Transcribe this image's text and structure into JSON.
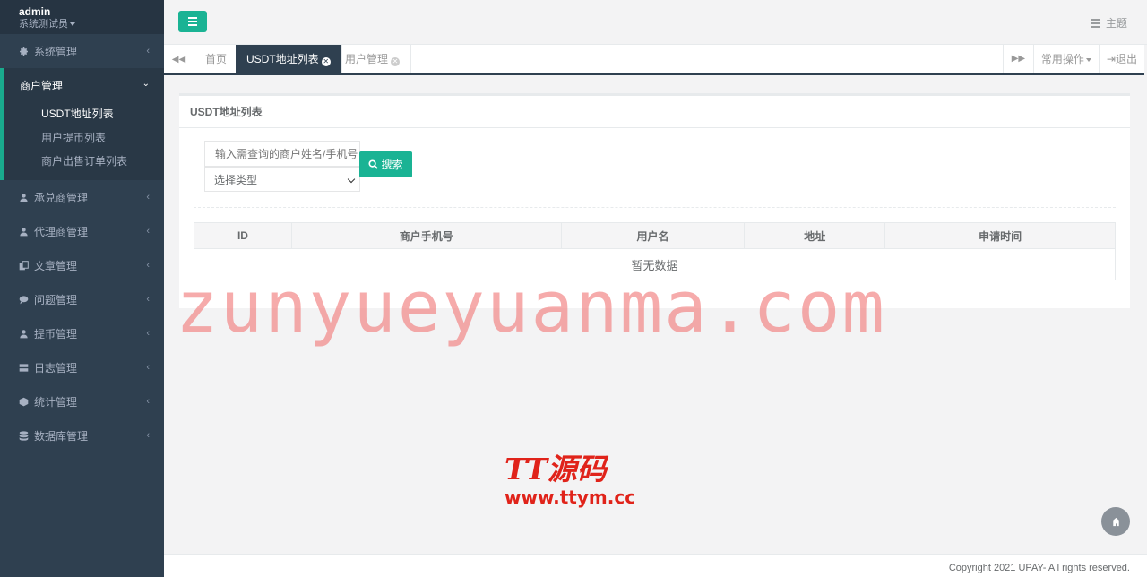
{
  "user": {
    "name": "admin",
    "role": "系统测试员"
  },
  "sidebar": {
    "items_top": [
      {
        "label": "系统管理",
        "icon": "gear-icon"
      }
    ],
    "active": {
      "label": "商户管理",
      "icon": "user-icon",
      "children": [
        {
          "label": "USDT地址列表",
          "current": true
        },
        {
          "label": "用户提币列表"
        },
        {
          "label": "商户出售订单列表"
        }
      ]
    },
    "items_bottom": [
      {
        "label": "承兑商管理",
        "icon": "user-icon"
      },
      {
        "label": "代理商管理",
        "icon": "user-icon"
      },
      {
        "label": "文章管理",
        "icon": "copy-icon"
      },
      {
        "label": "问题管理",
        "icon": "comment-icon"
      },
      {
        "label": "提币管理",
        "icon": "user-icon"
      },
      {
        "label": "日志管理",
        "icon": "server-icon"
      },
      {
        "label": "统计管理",
        "icon": "cube-icon"
      },
      {
        "label": "数据库管理",
        "icon": "database-icon"
      }
    ]
  },
  "header": {
    "theme_label": "主题"
  },
  "tabs": {
    "items": [
      {
        "label": "首页"
      },
      {
        "label": "USDT地址列表",
        "active": true
      },
      {
        "label": "用户管理"
      }
    ],
    "common_ops": "常用操作",
    "logout": "退出"
  },
  "panel": {
    "title": "USDT地址列表",
    "search_placeholder": "输入需查询的商户姓名/手机号",
    "type_select": "选择类型",
    "search_button": "搜索"
  },
  "table": {
    "columns": [
      "ID",
      "商户手机号",
      "用户名",
      "地址",
      "申请时间"
    ],
    "empty_text": "暂无数据"
  },
  "watermark": {
    "main": "zunyueyuanma.com",
    "logo": "TT源码",
    "url": "www.ttym.cc"
  },
  "footer": {
    "copyright": "Copyright 2021 UPAY- All rights reserved."
  },
  "colors": {
    "sidebar": "#2f4050",
    "accent": "#1ab394",
    "tab_active": "#2f4050"
  }
}
